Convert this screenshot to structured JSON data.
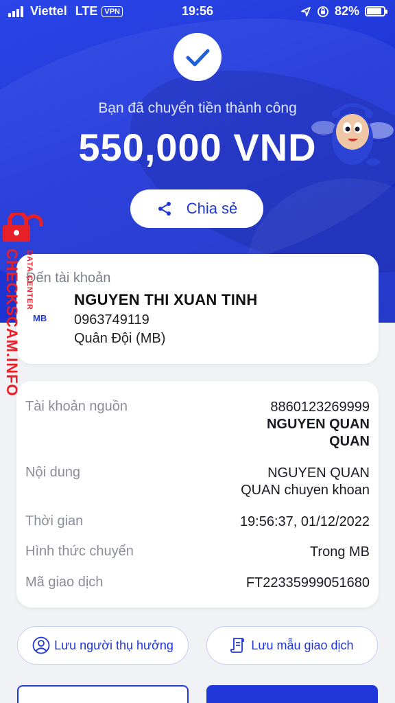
{
  "status_bar": {
    "carrier": "Viettel",
    "network": "LTE",
    "vpn": "VPN",
    "time": "19:56",
    "battery": "82%"
  },
  "hero": {
    "success_text": "Bạn đã chuyển tiền thành công",
    "amount": "550,000 VND",
    "share_label": "Chia sẻ"
  },
  "recipient": {
    "label": "Đến tài khoản",
    "bank_logo": "MB",
    "name": "NGUYEN THI XUAN TINH",
    "account": "0963749119",
    "bank": "Quân Đội (MB)"
  },
  "details": [
    {
      "label": "Tài khoản nguồn",
      "value_line1": "8860123269999",
      "value_bold1": "NGUYEN QUAN",
      "value_bold2": "QUAN"
    },
    {
      "label": "Nội dung",
      "value_line1": "NGUYEN QUAN",
      "value_line2": "QUAN chuyen khoan"
    },
    {
      "label": "Thời gian",
      "value_line1": "19:56:37, 01/12/2022"
    },
    {
      "label": "Hình thức chuyển",
      "value_line1": "Trong MB"
    },
    {
      "label": "Mã giao dịch",
      "value_line1": "FT22335999051680"
    }
  ],
  "actions": {
    "save_beneficiary": "Lưu người thụ hưởng",
    "save_template": "Lưu mẫu giao dịch"
  },
  "watermark": {
    "site": "CHECKSCAM.INFO",
    "sub": "DATA CENTER"
  },
  "colors": {
    "primary": "#1f36d8",
    "watermark": "#e8202a"
  },
  "icons": {
    "check": "check-icon",
    "share": "share-icon",
    "person": "user-circle-icon",
    "template": "document-icon",
    "lock": "lock-icon"
  }
}
